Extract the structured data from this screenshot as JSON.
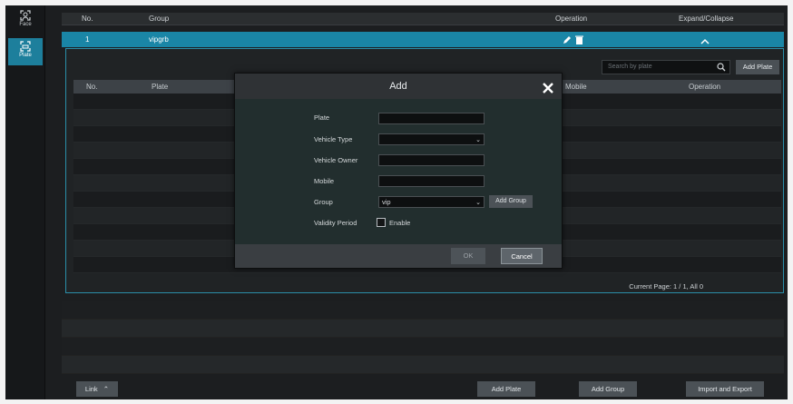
{
  "sidebar": {
    "items": [
      {
        "label": "Face",
        "icon": "face-icon"
      },
      {
        "label": "Plate",
        "icon": "plate-icon"
      }
    ]
  },
  "group_table": {
    "headers": {
      "no": "No.",
      "group": "Group",
      "operation": "Operation",
      "expand": "Expand/Collapse"
    },
    "rows": [
      {
        "no": "1",
        "group": "vipgrb"
      }
    ]
  },
  "plate_panel": {
    "search_placeholder": "Search by plate",
    "add_plate_label": "Add Plate",
    "headers": {
      "no": "No.",
      "plate": "Plate",
      "mobile": "Mobile",
      "operation": "Operation"
    },
    "page_info": "Current Page: 1 / 1, All 0"
  },
  "dialog": {
    "title": "Add",
    "fields": {
      "plate_label": "Plate",
      "vehicle_type_label": "Vehicle Type",
      "vehicle_owner_label": "Vehicle Owner",
      "mobile_label": "Mobile",
      "group_label": "Group",
      "group_value": "vip",
      "add_group_label": "Add Group",
      "validity_label": "Validity Period",
      "enable_label": "Enable"
    },
    "ok_label": "OK",
    "cancel_label": "Cancel"
  },
  "footer": {
    "link_label": "Link",
    "add_plate_label": "Add Plate",
    "add_group_label": "Add Group",
    "import_export_label": "Import and Export"
  },
  "colors": {
    "accent": "#1a86a6",
    "background": "#1c1e20"
  }
}
